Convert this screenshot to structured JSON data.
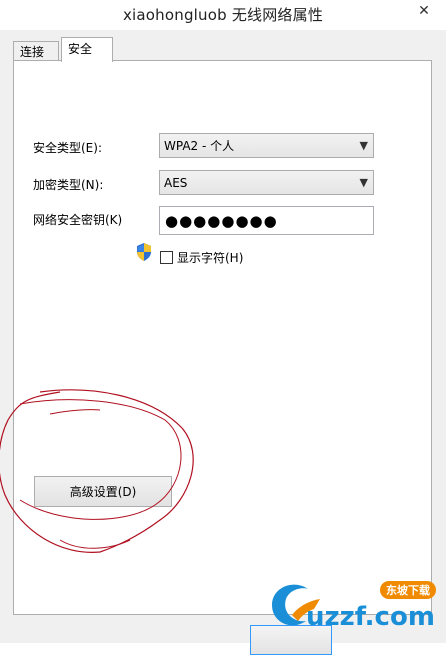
{
  "window": {
    "title": "xiaohongluob 无线网络属性",
    "close_glyph": "✕"
  },
  "tabs": [
    {
      "label": "连接",
      "active": false
    },
    {
      "label": "安全",
      "active": true
    }
  ],
  "security": {
    "security_type_label": "安全类型(E):",
    "security_type_value": "WPA2 - 个人",
    "encryption_type_label": "加密类型(N):",
    "encryption_type_value": "AES",
    "key_label": "网络安全密钥(K)",
    "key_value": "●●●●●●●●",
    "show_chars_label": "显示字符(H)",
    "show_chars_checked": false
  },
  "advanced_button_label": "高级设置(D)",
  "watermark": {
    "brand": "uzzf.com",
    "tagline": "东坡下载"
  },
  "colors": {
    "accent": "#3399ff",
    "annotation": "#b01020",
    "watermark_blue": "#1a8fd8",
    "watermark_orange": "#f08a00"
  },
  "icons": {
    "shield": "uac-shield-icon",
    "dropdown": "chevron-down-icon"
  }
}
